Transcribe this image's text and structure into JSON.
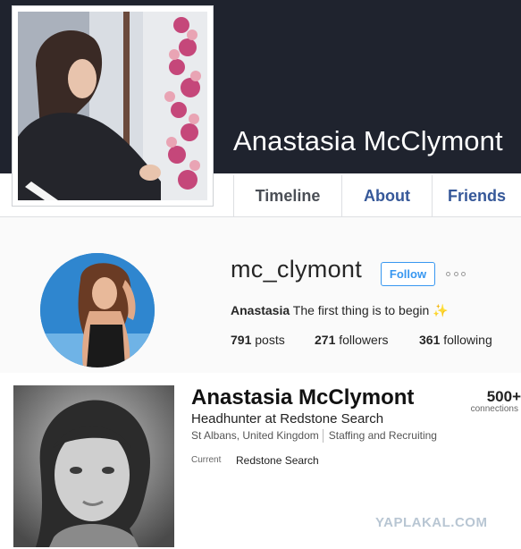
{
  "facebook": {
    "name": "Anastasia McClymont",
    "tabs": [
      {
        "label": "Timeline"
      },
      {
        "label": "About"
      },
      {
        "label": "Friends"
      }
    ]
  },
  "instagram": {
    "username": "mc_clymont",
    "follow_label": "Follow",
    "bio_name": "Anastasia",
    "bio_text": " The first thing is to begin ✨",
    "stats": {
      "posts_count": "791",
      "posts_label": " posts",
      "followers_count": "271",
      "followers_label": " followers",
      "following_count": "361",
      "following_label": " following"
    }
  },
  "linkedin": {
    "name": "Anastasia McClymont",
    "headline": "Headhunter at Redstone Search",
    "location": "St Albans, United Kingdom",
    "industry": "Staffing and Recruiting",
    "current_label": "Current",
    "current_value": "Redstone Search",
    "connections_count": "500+",
    "connections_label": "connections"
  },
  "watermark": "YAPLAKAL.COM",
  "colors": {
    "fb_cover": "#1f232e",
    "fb_link": "#365899",
    "ig_blue": "#3897f0",
    "page_bg": "#ffffff"
  }
}
